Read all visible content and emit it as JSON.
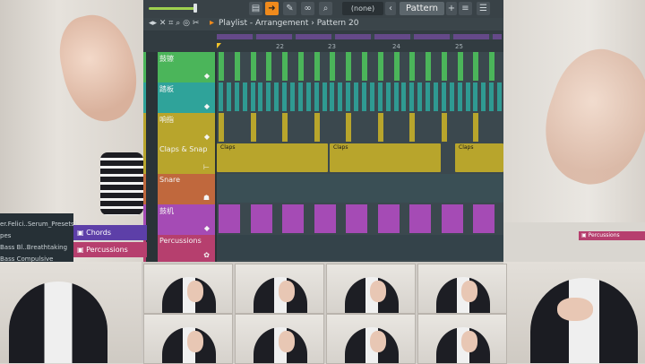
{
  "toolbar": {
    "selection_value": "(none)",
    "pattern_label": "Pattern 20",
    "buttons": [
      "piano-icon",
      "arrow-right-icon",
      "brush-icon",
      "link-icon",
      "zoom-icon",
      "mixer-icon",
      "playlist-icon"
    ]
  },
  "playlist": {
    "title": "Playlist - Arrangement",
    "separator": "›",
    "pattern": "Pattern 20",
    "ruler_labels": [
      "22",
      "23",
      "24",
      "25"
    ],
    "tracks": [
      {
        "name": "鼓镲",
        "color": "#4bb55a"
      },
      {
        "name": "踏板",
        "color": "#2fa39a"
      },
      {
        "name": "响指",
        "color": "#b8a52c"
      },
      {
        "name": "Claps & Snap",
        "color": "#b8a52c"
      },
      {
        "name": "Snare",
        "color": "#c0683d"
      },
      {
        "name": "鼓机",
        "color": "#a54bb5"
      },
      {
        "name": "Percussions",
        "color": "#b63f6e"
      }
    ],
    "clip_labels": {
      "claps": "Claps",
      "percussions": "Percussions",
      "chords": "Chords"
    }
  },
  "browser": {
    "lines": [
      "er.Felici..Serum_Presets]",
      "pes",
      "Bass Bl..Breathtaking",
      "Bass Compulsive"
    ]
  },
  "colors": {
    "accent": "#f08a1c",
    "green": "#4bb55a",
    "teal": "#2fa39a",
    "yellow": "#b8a52c",
    "orange": "#c0683d",
    "purple": "#a54bb5",
    "pink": "#b63f6e",
    "chords": "#5d3fa8"
  }
}
